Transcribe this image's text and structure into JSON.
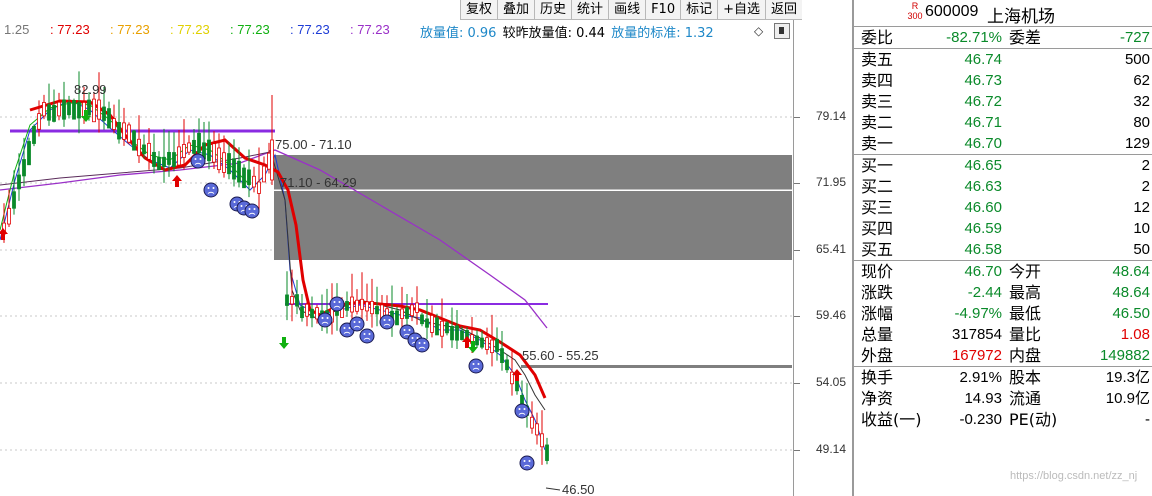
{
  "toolbar": {
    "buttons": [
      "复权",
      "叠加",
      "历史",
      "统计",
      "画线",
      "F10",
      "标记",
      "+自选",
      "返回"
    ]
  },
  "ma_line": {
    "items": [
      {
        "text": "1.25",
        "color": "#777777"
      },
      {
        "text": ": 77.23",
        "color": "#e00000"
      },
      {
        "text": ": 77.23",
        "color": "#e8a000"
      },
      {
        "text": ": 77.23",
        "color": "#e0d000"
      },
      {
        "text": ": 77.23",
        "color": "#10b010"
      },
      {
        "text": ": 77.23",
        "color": "#1e3cd6"
      },
      {
        "text": ": 77.23",
        "color": "#9a30c8"
      }
    ]
  },
  "vol_info": {
    "label1": "放量值: 0.96",
    "label2": "较昨放量值: 0.44",
    "label3": "放量的标准: 1.32"
  },
  "price_axis": {
    "labels": [
      "79.14",
      "71.95",
      "65.41",
      "59.46",
      "54.05",
      "49.14"
    ]
  },
  "chart_annotations": {
    "high": "82.99",
    "zone1": "75.00 - 71.10",
    "zone2": "71.10 - 64.29",
    "zone3": "55.60 - 55.25",
    "low": "46.50"
  },
  "stock": {
    "badge_r": "R",
    "badge_num": "300",
    "code": "600009",
    "name": "上海机场"
  },
  "order_ratio": {
    "label": "委比",
    "value": "-82.71%",
    "label2": "委差",
    "value2": "-727"
  },
  "asks": [
    {
      "label": "卖五",
      "price": "46.74",
      "volume": "500"
    },
    {
      "label": "卖四",
      "price": "46.73",
      "volume": "62"
    },
    {
      "label": "卖三",
      "price": "46.72",
      "volume": "32"
    },
    {
      "label": "卖二",
      "price": "46.71",
      "volume": "80"
    },
    {
      "label": "卖一",
      "price": "46.70",
      "volume": "129"
    }
  ],
  "bids": [
    {
      "label": "买一",
      "price": "46.65",
      "volume": "2"
    },
    {
      "label": "买二",
      "price": "46.63",
      "volume": "2"
    },
    {
      "label": "买三",
      "price": "46.60",
      "volume": "12"
    },
    {
      "label": "买四",
      "price": "46.59",
      "volume": "10"
    },
    {
      "label": "买五",
      "price": "46.58",
      "volume": "50"
    }
  ],
  "stats1": [
    {
      "l1": "现价",
      "v1": "46.70",
      "c1": "green",
      "l2": "今开",
      "v2": "48.64",
      "c2": "green"
    },
    {
      "l1": "涨跌",
      "v1": "-2.44",
      "c1": "green",
      "l2": "最高",
      "v2": "48.64",
      "c2": "green"
    },
    {
      "l1": "涨幅",
      "v1": "-4.97%",
      "c1": "green",
      "l2": "最低",
      "v2": "46.50",
      "c2": "green"
    },
    {
      "l1": "总量",
      "v1": "317854",
      "c1": "black",
      "l2": "量比",
      "v2": "1.08",
      "c2": "red"
    },
    {
      "l1": "外盘",
      "v1": "167972",
      "c1": "red",
      "l2": "内盘",
      "v2": "149882",
      "c2": "green"
    }
  ],
  "stats2": [
    {
      "l1": "换手",
      "v1": "2.91%",
      "c1": "black",
      "l2": "股本",
      "v2": "19.3亿",
      "c2": "black"
    },
    {
      "l1": "净资",
      "v1": "14.93",
      "c1": "black",
      "l2": "流通",
      "v2": "10.9亿",
      "c2": "black"
    },
    {
      "l1": "收益(一)",
      "v1": "-0.230",
      "c1": "black",
      "l2": "PE(动)",
      "v2": "-",
      "c2": "black"
    }
  ],
  "watermark": "https://blog.csdn.net/zz_nj",
  "colors": {
    "up": "#e00000",
    "down": "#0a8a2a",
    "zone": "#7f7f7f",
    "purple": "#8a2be2",
    "panel_border": "#9a9a9a"
  }
}
